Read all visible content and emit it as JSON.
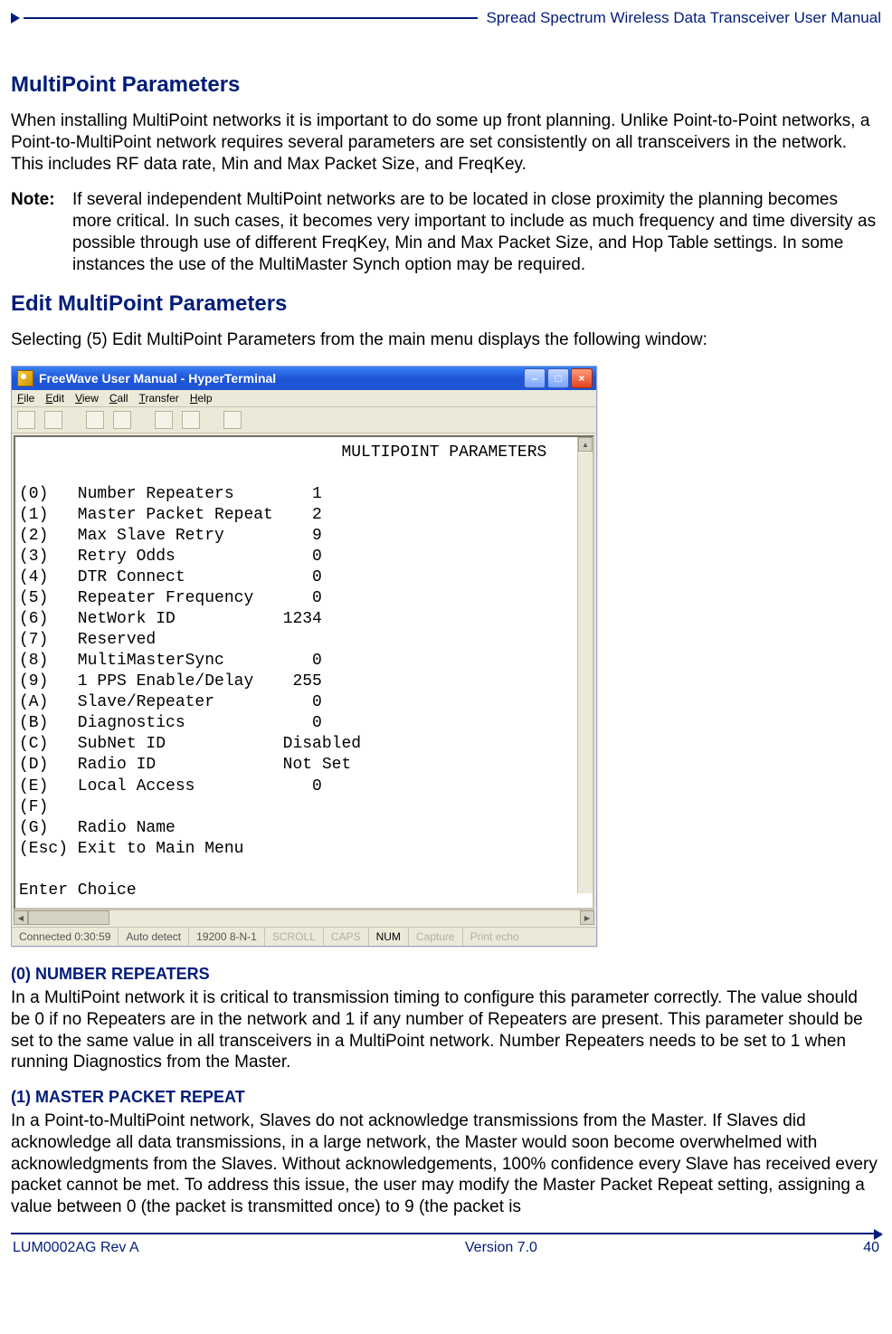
{
  "header": {
    "doc_title": "Spread Spectrum Wireless Data Transceiver User Manual"
  },
  "s1": {
    "title": "MultiPoint Parameters",
    "p1": "When installing MultiPoint networks it is important to do some up front planning. Unlike Point-to-Point networks, a Point-to-MultiPoint network requires several parameters are set consistently on all transceivers in the network. This includes RF data rate, Min and Max Packet Size, and FreqKey.",
    "note_label": "Note:",
    "note_body": "If several independent MultiPoint networks are to be located in close proximity the planning becomes more critical. In such cases, it becomes very important to include as much frequency and time diversity as possible through use of different FreqKey, Min and Max Packet Size, and Hop Table settings. In some instances the use of the MultiMaster Synch option may be required."
  },
  "s2": {
    "title": "Edit MultiPoint Parameters",
    "p1": "Selecting (5) Edit MultiPoint Parameters from the main menu displays the following window:"
  },
  "terminal": {
    "window_title": "FreeWave User Manual - HyperTerminal",
    "menu": {
      "file": "File",
      "edit": "Edit",
      "view": "View",
      "call": "Call",
      "transfer": "Transfer",
      "help": "Help"
    },
    "screen_title": "MULTIPOINT PARAMETERS",
    "params": [
      {
        "key": "(0)",
        "name": "Number Repeaters",
        "value": "1"
      },
      {
        "key": "(1)",
        "name": "Master Packet Repeat",
        "value": "2"
      },
      {
        "key": "(2)",
        "name": "Max Slave Retry",
        "value": "9"
      },
      {
        "key": "(3)",
        "name": "Retry Odds",
        "value": "0"
      },
      {
        "key": "(4)",
        "name": "DTR Connect",
        "value": "0"
      },
      {
        "key": "(5)",
        "name": "Repeater Frequency",
        "value": "0"
      },
      {
        "key": "(6)",
        "name": "NetWork ID",
        "value": "1234"
      },
      {
        "key": "(7)",
        "name": "Reserved",
        "value": ""
      },
      {
        "key": "(8)",
        "name": "MultiMasterSync",
        "value": "0"
      },
      {
        "key": "(9)",
        "name": "1 PPS Enable/Delay",
        "value": "255"
      },
      {
        "key": "(A)",
        "name": "Slave/Repeater",
        "value": "0"
      },
      {
        "key": "(B)",
        "name": "Diagnostics",
        "value": "0"
      },
      {
        "key": "(C)",
        "name": "SubNet ID",
        "value": "Disabled"
      },
      {
        "key": "(D)",
        "name": "Radio ID",
        "value": "Not Set"
      },
      {
        "key": "(E)",
        "name": "Local Access",
        "value": "0"
      },
      {
        "key": "(F)",
        "name": "",
        "value": ""
      },
      {
        "key": "(G)",
        "name": "Radio Name",
        "value": ""
      },
      {
        "key": "(Esc)",
        "name": "Exit to Main Menu",
        "value": ""
      }
    ],
    "prompt": "Enter Choice",
    "status": {
      "connected": "Connected 0:30:59",
      "detect": "Auto detect",
      "port": "19200 8-N-1",
      "scroll": "SCROLL",
      "caps": "CAPS",
      "num": "NUM",
      "capture": "Capture",
      "echo": "Print echo"
    }
  },
  "s3": {
    "h_a": "(0) N",
    "h_a2": "UMBER ",
    "h_a3": "R",
    "h_a4": "EPEATERS",
    "p_a": "In a MultiPoint network it is critical to transmission timing to configure this parameter correctly.  The value should be 0 if no Repeaters are in the network and 1 if any number of Repeaters are present.  This parameter should be set to the same value in all transceivers in a MultiPoint network. Number Repeaters needs to be set to 1 when running Diagnostics from the Master.",
    "h_b": "(1) M",
    "h_b2": "ASTER ",
    "h_b3": "P",
    "h_b4": "ACKET ",
    "h_b5": "R",
    "h_b6": "EPEAT",
    "p_b": "In a Point-to-MultiPoint network, Slaves do not acknowledge transmissions from the Master. If Slaves did acknowledge all data transmissions, in a large network, the Master would soon become overwhelmed with acknowledgments from the Slaves.  Without acknowledgements, 100% confidence every Slave has received every packet cannot be met. To address this issue, the user may modify the Master Packet Repeat setting, assigning a value between 0 (the packet is transmitted once) to 9 (the packet is"
  },
  "footer": {
    "left": "LUM0002AG Rev A",
    "center": "Version 7.0",
    "right": "40"
  }
}
